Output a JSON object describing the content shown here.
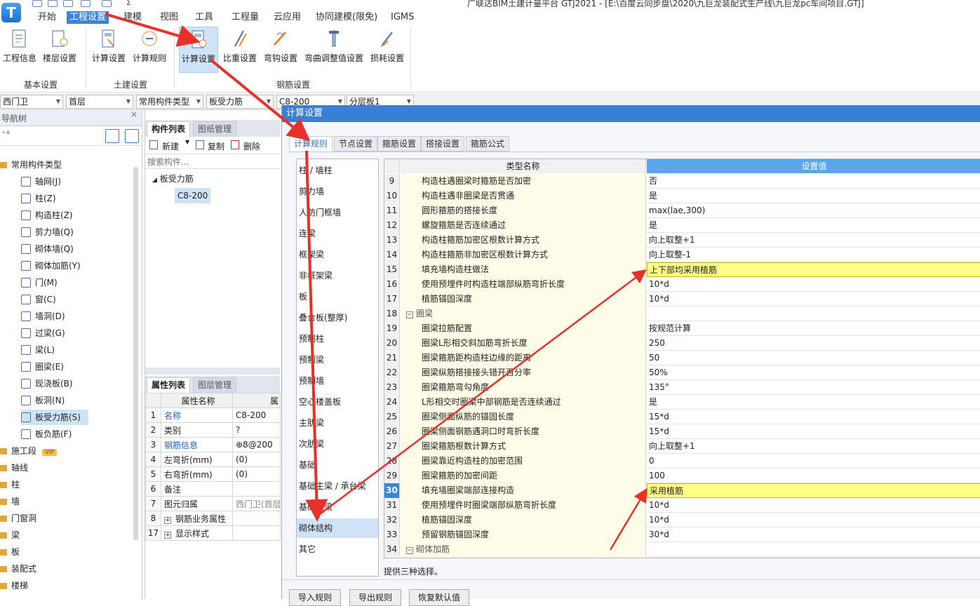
{
  "app_title": "广联达BIM土建计量平台 GTJ2021 - [E:\\百度云同步盘\\2020\\九巨龙装配式生产线\\九巨龙pc车间项目.GTJ]",
  "logo_letter": "T",
  "menu": [
    "开始",
    "工程设置",
    "建模",
    "视图",
    "工具",
    "工程量",
    "云应用",
    "协同建模(限免)",
    "IGMS"
  ],
  "ribbon": {
    "groups": [
      {
        "label": "基本设置",
        "buttons": [
          "工程信息",
          "楼层设置"
        ]
      },
      {
        "label": "土建设置",
        "buttons": [
          "计算设置",
          "计算规则"
        ]
      },
      {
        "label": "钢筋设置",
        "buttons": [
          "计算设置",
          "比重设置",
          "弯钩设置",
          "弯曲调整值设置",
          "损耗设置"
        ]
      }
    ]
  },
  "selectors": [
    "西门卫",
    "首层",
    "常用构件类型",
    "板受力筋",
    "C8-200",
    "分层板1"
  ],
  "nav": {
    "title": "导航树",
    "root": "常用构件类型",
    "items": [
      "轴网(J)",
      "柱(Z)",
      "构造柱(Z)",
      "剪力墙(Q)",
      "砌体墙(Q)",
      "砌体加筋(Y)",
      "门(M)",
      "窗(C)",
      "墙洞(D)",
      "过梁(G)",
      "梁(L)",
      "圈梁(E)",
      "现浇板(B)",
      "板洞(N)",
      "板受力筋(S)",
      "板负筋(F)"
    ],
    "folders": [
      "施工段",
      "轴线",
      "柱",
      "墙",
      "门窗洞",
      "梁",
      "板",
      "装配式",
      "楼梯"
    ],
    "vip": "VIP"
  },
  "component_panel": {
    "tabs": [
      "构件列表",
      "图纸管理"
    ],
    "toolbar": {
      "new": "新建",
      "copy": "复制",
      "delete": "删除"
    },
    "search_placeholder": "搜索构件...",
    "tree_parent": "板受力筋",
    "tree_child": "C8-200"
  },
  "properties": {
    "tabs": [
      "属性列表",
      "图层管理"
    ],
    "header_name": "属性名称",
    "header_value": "属",
    "rows": [
      {
        "n": "1",
        "name": "名称",
        "value": "C8-200"
      },
      {
        "n": "2",
        "name": "类别",
        "value": "?"
      },
      {
        "n": "3",
        "name": "钢筋信息",
        "value": "⊕8@200"
      },
      {
        "n": "4",
        "name": "左弯折(mm)",
        "value": "(0)"
      },
      {
        "n": "5",
        "name": "右弯折(mm)",
        "value": "(0)"
      },
      {
        "n": "6",
        "name": "备注",
        "value": ""
      },
      {
        "n": "7",
        "name": "图元归属",
        "value": "西门卫(首层"
      },
      {
        "n": "8",
        "name": "钢筋业务属性",
        "value": ""
      },
      {
        "n": "17",
        "name": "显示样式",
        "value": ""
      }
    ]
  },
  "dialog": {
    "title": "计算设置",
    "tabs": [
      "计算规则",
      "节点设置",
      "箍筋设置",
      "搭接设置",
      "箍筋公式"
    ],
    "categories": [
      "柱 / 墙柱",
      "剪力墙",
      "人防门框墙",
      "连梁",
      "框架梁",
      "非框架梁",
      "板",
      "叠合板(整厚)",
      "预制柱",
      "预制梁",
      "预制墙",
      "空心楼盖板",
      "主肋梁",
      "次肋梁",
      "基础",
      "基础主梁 / 承台梁",
      "基础次梁",
      "砌体结构",
      "其它"
    ],
    "grid_header": {
      "name": "类型名称",
      "value": "设置值"
    },
    "rows": [
      {
        "n": "9",
        "name": "构造柱遇圈梁时箍筋是否加密",
        "value": "否"
      },
      {
        "n": "10",
        "name": "构造柱遇非圈梁是否贯通",
        "value": "是"
      },
      {
        "n": "11",
        "name": "圆形箍筋的搭接长度",
        "value": "max(lae,300)"
      },
      {
        "n": "12",
        "name": "螺旋箍筋是否连续通过",
        "value": "是"
      },
      {
        "n": "13",
        "name": "构造柱箍筋加密区根数计算方式",
        "value": "向上取整+1"
      },
      {
        "n": "14",
        "name": "构造柱箍筋非加密区根数计算方式",
        "value": "向上取整-1"
      },
      {
        "n": "15",
        "name": "填充墙构造柱做法",
        "value": "上下部均采用植筋"
      },
      {
        "n": "16",
        "name": "使用预埋件时构造柱端部纵筋弯折长度",
        "value": "10*d"
      },
      {
        "n": "17",
        "name": "植筋锚固深度",
        "value": "10*d"
      },
      {
        "n": "18",
        "name": "圈梁",
        "value": ""
      },
      {
        "n": "19",
        "name": "圈梁拉筋配置",
        "value": "按规范计算"
      },
      {
        "n": "20",
        "name": "圈梁L形相交斜加筋弯折长度",
        "value": "250"
      },
      {
        "n": "21",
        "name": "圈梁箍筋距构造柱边缘的距离",
        "value": "50"
      },
      {
        "n": "22",
        "name": "圈梁纵筋搭接接头错开百分率",
        "value": "50%"
      },
      {
        "n": "23",
        "name": "圈梁箍筋弯勾角度",
        "value": "135°"
      },
      {
        "n": "24",
        "name": "L形相交时圈梁中部钢筋是否连续通过",
        "value": "是"
      },
      {
        "n": "25",
        "name": "圈梁侧面纵筋的锚固长度",
        "value": "15*d"
      },
      {
        "n": "26",
        "name": "圈梁侧面钢筋遇洞口时弯折长度",
        "value": "15*d"
      },
      {
        "n": "27",
        "name": "圈梁箍筋根数计算方式",
        "value": "向上取整+1"
      },
      {
        "n": "28",
        "name": "圈梁靠近构造柱的加密范围",
        "value": "0"
      },
      {
        "n": "29",
        "name": "圈梁箍筋的加密间距",
        "value": "100"
      },
      {
        "n": "30",
        "name": "填充墙圈梁端部连接构造",
        "value": "采用植筋"
      },
      {
        "n": "31",
        "name": "使用预埋件时圈梁端部纵筋弯折长度",
        "value": "10*d"
      },
      {
        "n": "32",
        "name": "植筋锚固深度",
        "value": "10*d"
      },
      {
        "n": "33",
        "name": "预留钢筋锚固深度",
        "value": "30*d"
      },
      {
        "n": "34",
        "name": "砌体加筋",
        "value": ""
      }
    ],
    "hint": "提供三种选择。",
    "buttons": [
      "导入规则",
      "导出规则",
      "恢复默认值"
    ]
  }
}
